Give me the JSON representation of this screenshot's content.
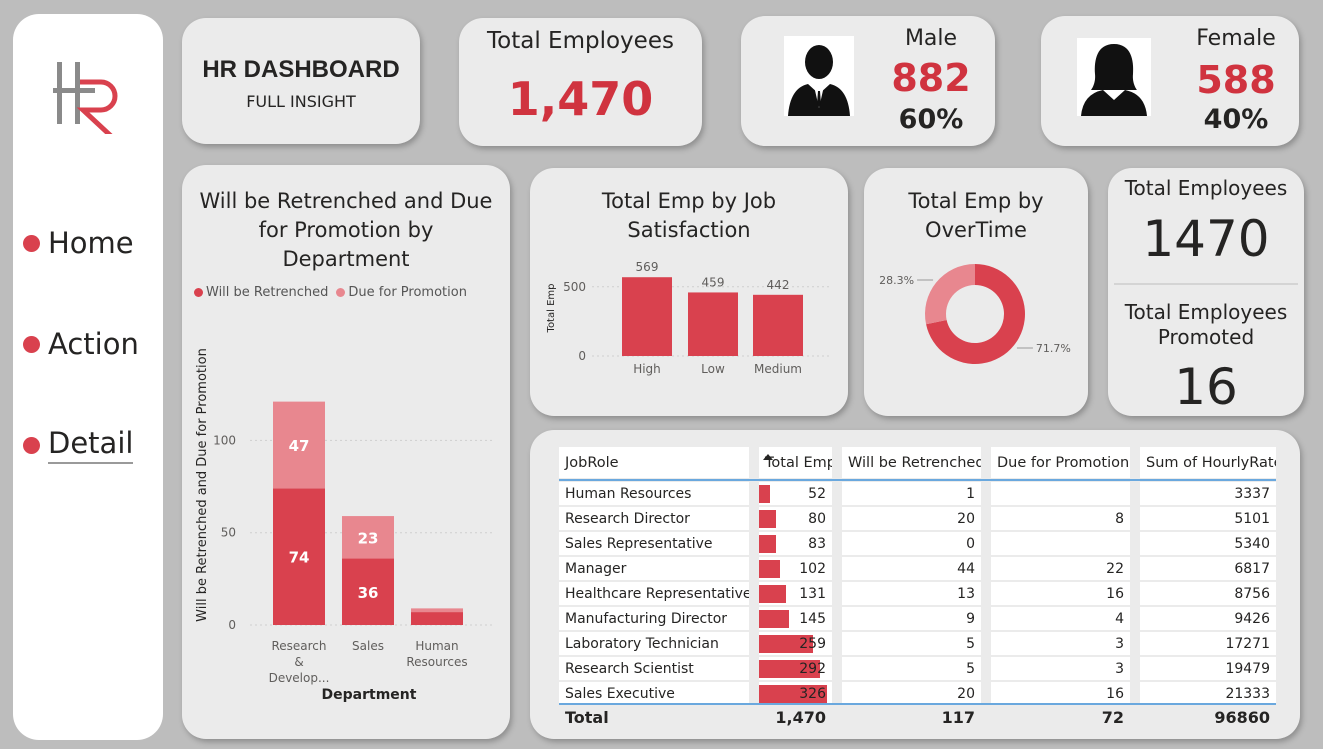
{
  "sidebar": {
    "logo_text": "HR",
    "nav": [
      {
        "label": "Home"
      },
      {
        "label": "Action"
      },
      {
        "label": "Detail"
      }
    ]
  },
  "header": {
    "title": "HR DASHBOARD",
    "subtitle": "FULL INSIGHT"
  },
  "kpi": {
    "total_employees": {
      "label": "Total Employees",
      "value": "1,470"
    },
    "male": {
      "label": "Male",
      "value": "882",
      "pct": "60%"
    },
    "female": {
      "label": "Female",
      "value": "588",
      "pct": "40%"
    },
    "side_total": {
      "label": "Total Employees",
      "value": "1470"
    },
    "promoted": {
      "label": "Total Employees Promoted",
      "value": "16"
    }
  },
  "colors": {
    "accent": "#d9414e",
    "accent_light": "#e8878f",
    "card": "#ebebeb",
    "background": "#bdbdbd"
  },
  "chart_data": [
    {
      "type": "bar",
      "stacked": true,
      "title": "Will be Retrenched and Due for Promotion by Department",
      "xlabel": "Department",
      "ylabel": "Will be Retrenched and Due for Promotion",
      "categories": [
        "Research & Develop...",
        "Sales",
        "Human Resources"
      ],
      "series": [
        {
          "name": "Will be Retrenched",
          "values": [
            74,
            36,
            7
          ],
          "color": "#d9414e"
        },
        {
          "name": "Due for Promotion",
          "values": [
            47,
            23,
            2
          ],
          "color": "#e8878f"
        }
      ],
      "yticks": [
        "0",
        "50",
        "100"
      ],
      "ylim": [
        0,
        130
      ],
      "legend": "top-left",
      "grid": true
    },
    {
      "type": "bar",
      "title": "Total Emp by Job Satisfaction",
      "xlabel": "",
      "ylabel": "Total Emp",
      "categories": [
        "High",
        "Low",
        "Medium"
      ],
      "values": [
        569,
        459,
        442
      ],
      "yticks": [
        "0",
        "500"
      ],
      "ylim": [
        0,
        650
      ],
      "grid": true
    },
    {
      "type": "pie",
      "donut": true,
      "title": "Total Emp by OverTime",
      "slices": [
        {
          "value": 71.7,
          "label": "71.7%",
          "color": "#d9414e"
        },
        {
          "value": 28.3,
          "label": "28.3%",
          "color": "#e8878f"
        }
      ]
    }
  ],
  "table": {
    "columns": [
      "JobRole",
      "Total Emp",
      "Will be Retrenched",
      "Due for Promotion",
      "Sum of HourlyRate"
    ],
    "rows": [
      {
        "role": "Human Resources",
        "total": 52,
        "retrenched": "1",
        "promotion": "",
        "hourly": "3337"
      },
      {
        "role": "Research Director",
        "total": 80,
        "retrenched": "20",
        "promotion": "8",
        "hourly": "5101"
      },
      {
        "role": "Sales Representative",
        "total": 83,
        "retrenched": "0",
        "promotion": "",
        "hourly": "5340"
      },
      {
        "role": "Manager",
        "total": 102,
        "retrenched": "44",
        "promotion": "22",
        "hourly": "6817"
      },
      {
        "role": "Healthcare Representative",
        "total": 131,
        "retrenched": "13",
        "promotion": "16",
        "hourly": "8756"
      },
      {
        "role": "Manufacturing Director",
        "total": 145,
        "retrenched": "9",
        "promotion": "4",
        "hourly": "9426"
      },
      {
        "role": "Laboratory Technician",
        "total": 259,
        "retrenched": "5",
        "promotion": "3",
        "hourly": "17271"
      },
      {
        "role": "Research Scientist",
        "total": 292,
        "retrenched": "5",
        "promotion": "3",
        "hourly": "19479"
      },
      {
        "role": "Sales Executive",
        "total": 326,
        "retrenched": "20",
        "promotion": "16",
        "hourly": "21333"
      }
    ],
    "totals": {
      "label": "Total",
      "total": "1,470",
      "retrenched": "117",
      "promotion": "72",
      "hourly": "96860"
    }
  }
}
